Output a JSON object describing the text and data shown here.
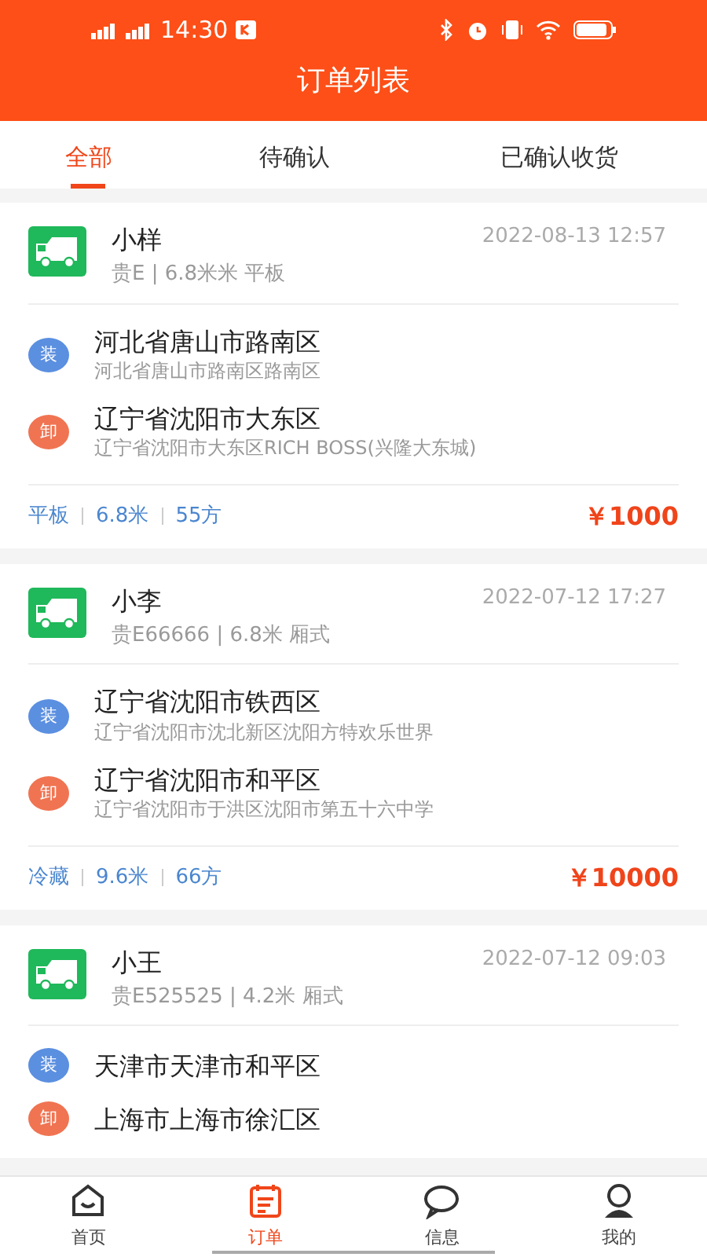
{
  "status_bar": {
    "time": "14:30"
  },
  "header": {
    "title": "订单列表"
  },
  "tabs": [
    {
      "label": "全部",
      "selected": true
    },
    {
      "label": "待确认",
      "selected": false
    },
    {
      "label": "已确认收货",
      "selected": false
    }
  ],
  "orders": [
    {
      "name": "小样",
      "vehicle": "贵E | 6.8米米 平板",
      "time": "2022-08-13 12:57",
      "stops": [
        {
          "kind": "load",
          "badge": "装",
          "address": "河北省唐山市路南区",
          "detail": "河北省唐山市路南区路南区"
        },
        {
          "kind": "unload",
          "badge": "卸",
          "address": "辽宁省沈阳市大东区",
          "detail": "辽宁省沈阳市大东区RICH BOSS(兴隆大东城)"
        }
      ],
      "tags": [
        "平板",
        "6.8米",
        "55方"
      ],
      "price": "￥1000"
    },
    {
      "name": "小李",
      "vehicle": "贵E66666 | 6.8米 厢式",
      "time": "2022-07-12 17:27",
      "stops": [
        {
          "kind": "load",
          "badge": "装",
          "address": "辽宁省沈阳市铁西区",
          "detail": "辽宁省沈阳市沈北新区沈阳方特欢乐世界"
        },
        {
          "kind": "unload",
          "badge": "卸",
          "address": "辽宁省沈阳市和平区",
          "detail": "辽宁省沈阳市于洪区沈阳市第五十六中学"
        }
      ],
      "tags": [
        "冷藏",
        "9.6米",
        "66方"
      ],
      "price": "￥10000"
    },
    {
      "name": "小王",
      "vehicle": "贵E525525 | 4.2米 厢式",
      "time": "2022-07-12 09:03",
      "stops": [
        {
          "kind": "load",
          "badge": "装",
          "address": "天津市天津市和平区"
        },
        {
          "kind": "unload",
          "badge": "卸",
          "address": "上海市上海市徐汇区"
        }
      ]
    }
  ],
  "tab_bar": [
    {
      "kind": "home",
      "label": "首页",
      "selected": false
    },
    {
      "kind": "orders",
      "label": "订单",
      "selected": true
    },
    {
      "kind": "messages",
      "label": "信息",
      "selected": false
    },
    {
      "kind": "profile",
      "label": "我的",
      "selected": false
    }
  ]
}
